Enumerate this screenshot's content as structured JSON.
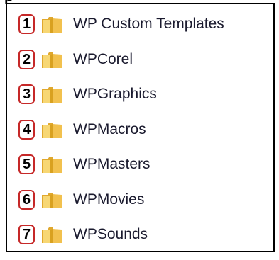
{
  "header_fragment": "p",
  "folders": [
    {
      "number": "1",
      "name": "WP Custom Templates",
      "icon": "folder-icon"
    },
    {
      "number": "2",
      "name": "WPCorel",
      "icon": "folder-icon"
    },
    {
      "number": "3",
      "name": "WPGraphics",
      "icon": "folder-icon"
    },
    {
      "number": "4",
      "name": "WPMacros",
      "icon": "folder-icon"
    },
    {
      "number": "5",
      "name": "WPMasters",
      "icon": "folder-icon"
    },
    {
      "number": "6",
      "name": "WPMovies",
      "icon": "folder-icon"
    },
    {
      "number": "7",
      "name": "WPSounds",
      "icon": "folder-icon"
    }
  ],
  "colors": {
    "badge_border": "#c62828",
    "folder_yellow": "#f2c14e",
    "text": "#1a1a2e"
  }
}
